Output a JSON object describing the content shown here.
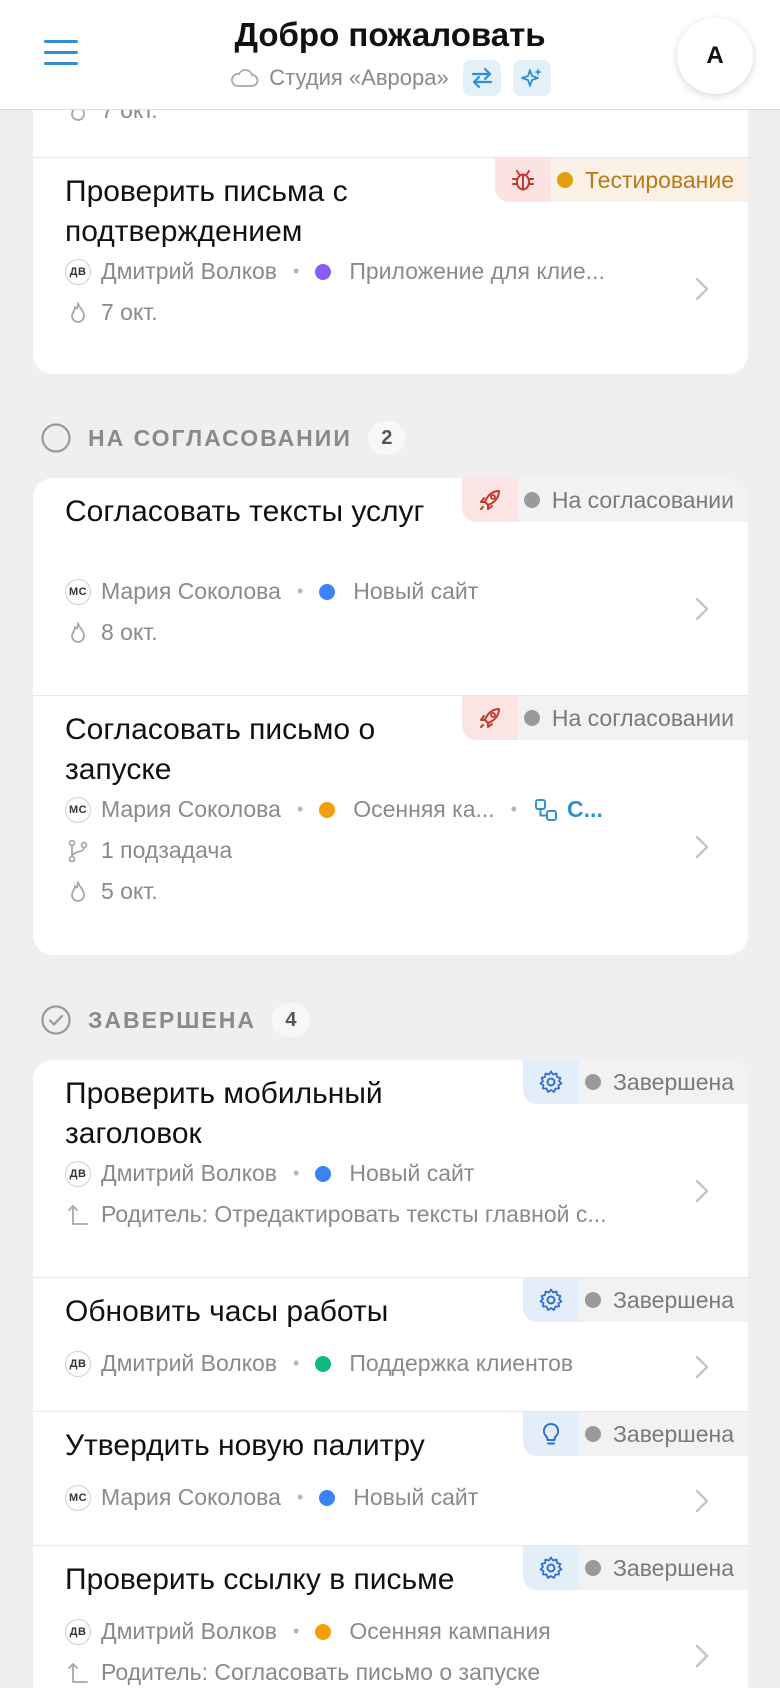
{
  "header": {
    "title": "Добро пожаловать",
    "studio": "Студия «Аврора»",
    "avatar": "A"
  },
  "top_card": {
    "partial_date": "7 окт.",
    "task": {
      "title": "Проверить письма с подтверждением",
      "badge": "Тестирование",
      "badge_dot": "#e1a10e",
      "assignee_initials": "ДВ",
      "assignee": "Дмитрий Волков",
      "project": "Приложение для клие...",
      "project_color": "#8b5cf6",
      "date": "7 окт."
    }
  },
  "sections": {
    "review": {
      "label": "НА СОГЛАСОВАНИИ",
      "count": "2",
      "tasks": [
        {
          "title": "Согласовать тексты услуг",
          "badge": "На согласовании",
          "assignee_initials": "МС",
          "assignee": "Мария Соколова",
          "project": "Новый сайт",
          "project_color": "#3b82f6",
          "date": "8 окт."
        },
        {
          "title": "Согласовать письмо о запуске",
          "badge": "На согласовании",
          "assignee_initials": "МС",
          "assignee": "Мария Соколова",
          "project": "Осенняя ка...",
          "project_color": "#f59e0b",
          "link": "С...",
          "subtasks": "1 подзадача",
          "date": "5 окт."
        }
      ]
    },
    "done": {
      "label": "ЗАВЕРШЕНА",
      "count": "4",
      "tasks": [
        {
          "title": "Проверить мобильный заголовок",
          "badge": "Завершена",
          "assignee_initials": "ДВ",
          "assignee": "Дмитрий Волков",
          "project": "Новый сайт",
          "project_color": "#3b82f6",
          "parent": "Родитель: Отредактировать тексты главной с..."
        },
        {
          "title": "Обновить часы работы",
          "badge": "Завершена",
          "assignee_initials": "ДВ",
          "assignee": "Дмитрий Волков",
          "project": "Поддержка клиентов",
          "project_color": "#10b981"
        },
        {
          "title": "Утвердить новую палитру",
          "badge": "Завершена",
          "assignee_initials": "МС",
          "assignee": "Мария Соколова",
          "project": "Новый сайт",
          "project_color": "#3b82f6"
        },
        {
          "title": "Проверить ссылку в письме",
          "badge": "Завершена",
          "assignee_initials": "ДВ",
          "assignee": "Дмитрий Волков",
          "project": "Осенняя кампания",
          "project_color": "#f59e0b",
          "parent": "Родитель: Согласовать письмо о запуске"
        }
      ]
    }
  }
}
